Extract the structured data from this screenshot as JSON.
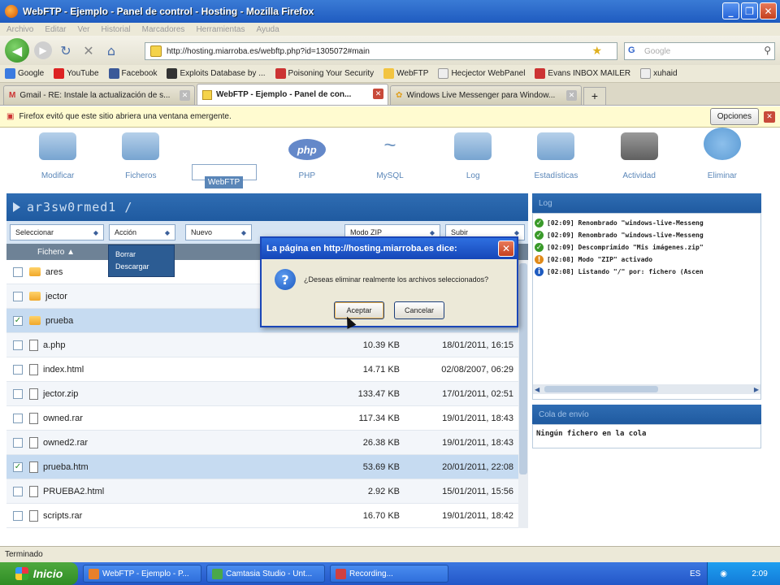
{
  "window": {
    "title": "WebFTP - Ejemplo - Panel de control - Hosting - Mozilla Firefox"
  },
  "menu": [
    "Archivo",
    "Editar",
    "Ver",
    "Historial",
    "Marcadores",
    "Herramientas",
    "Ayuda"
  ],
  "address": {
    "url": "http://hosting.miarroba.es/webftp.php?id=1305072#main",
    "search_placeholder": "Google",
    "search_engine_label": "G"
  },
  "bookmarks": [
    {
      "label": "Google",
      "color": "#3b7be0"
    },
    {
      "label": "YouTube",
      "color": "#d22"
    },
    {
      "label": "Facebook",
      "color": "#3b5998"
    },
    {
      "label": "Exploits Database by ...",
      "color": "#333"
    },
    {
      "label": "Poisoning Your Security",
      "color": "#c33"
    },
    {
      "label": "WebFTP",
      "color": "#f2c440"
    },
    {
      "label": "Hecjector WebPanel",
      "color": "#eee"
    },
    {
      "label": "Evans INBOX MAILER",
      "color": "#c33"
    },
    {
      "label": "xuhaid",
      "color": "#eee"
    }
  ],
  "tabs": [
    {
      "label": "Gmail - RE: Instale la actualización de s...",
      "active": false
    },
    {
      "label": "WebFTP - Ejemplo - Panel de con...",
      "active": true
    },
    {
      "label": "Windows Live Messenger para Window...",
      "active": false
    }
  ],
  "newtab_label": "+",
  "notification": {
    "text": "Firefox evitó que este sitio abriera una ventana emergente.",
    "button": "Opciones"
  },
  "tools": [
    {
      "label": "Modificar",
      "selected": false
    },
    {
      "label": "Ficheros",
      "selected": false
    },
    {
      "label": "WebFTP",
      "selected": true
    },
    {
      "label": "PHP",
      "selected": false
    },
    {
      "label": "MySQL",
      "selected": false
    },
    {
      "label": "Log",
      "selected": false
    },
    {
      "label": "Estadísticas",
      "selected": false
    },
    {
      "label": "Actividad",
      "selected": false
    },
    {
      "label": "Eliminar",
      "selected": false
    }
  ],
  "php_logo_text": "php",
  "path": "ar3sw0rmed1 /",
  "selects": {
    "select": "Seleccionar",
    "action": "Acción",
    "new": "Nuevo",
    "mode": "Modo ZIP",
    "upload": "Subir"
  },
  "column_header": "Fichero ▲",
  "action_menu": [
    "Borrar",
    "Descargar"
  ],
  "files": [
    {
      "name": "ares",
      "type": "folder",
      "size": "",
      "date": "",
      "checked": false
    },
    {
      "name": "jector",
      "type": "folder",
      "size": "",
      "date": "",
      "checked": false
    },
    {
      "name": "prueba",
      "type": "folder",
      "size": "",
      "date": "",
      "checked": true
    },
    {
      "name": "a.php",
      "type": "file",
      "size": "10.39 KB",
      "date": "18/01/2011, 16:15",
      "checked": false
    },
    {
      "name": "index.html",
      "type": "file",
      "size": "14.71 KB",
      "date": "02/08/2007, 06:29",
      "checked": false
    },
    {
      "name": "jector.zip",
      "type": "file",
      "size": "133.47 KB",
      "date": "17/01/2011, 02:51",
      "checked": false
    },
    {
      "name": "owned.rar",
      "type": "file",
      "size": "117.34 KB",
      "date": "19/01/2011, 18:43",
      "checked": false
    },
    {
      "name": "owned2.rar",
      "type": "file",
      "size": "26.38 KB",
      "date": "19/01/2011, 18:43",
      "checked": false
    },
    {
      "name": "prueba.htm",
      "type": "file",
      "size": "53.69 KB",
      "date": "20/01/2011, 22:08",
      "checked": true
    },
    {
      "name": "PRUEBA2.html",
      "type": "file",
      "size": "2.92 KB",
      "date": "15/01/2011, 15:56",
      "checked": false
    },
    {
      "name": "scripts.rar",
      "type": "file",
      "size": "16.70 KB",
      "date": "19/01/2011, 18:42",
      "checked": false
    }
  ],
  "log": {
    "title": "Log",
    "entries": [
      {
        "icon": "check",
        "color": "#3a9a2a",
        "text": "[02:09] Renombrado \"windows-live-Messeng"
      },
      {
        "icon": "check",
        "color": "#3a9a2a",
        "text": "[02:09] Renombrado \"windows-live-Messeng"
      },
      {
        "icon": "check",
        "color": "#3a9a2a",
        "text": "[02:09] Descomprimido \"Mis imágenes.zip\""
      },
      {
        "icon": "warning",
        "color": "#e08a1a",
        "text": "[02:08] Modo \"ZIP\" activado"
      },
      {
        "icon": "info",
        "color": "#1e5bc0",
        "text": "[02:08] Listando \"/\" por: fichero (Ascen"
      }
    ]
  },
  "queue": {
    "title": "Cola de envío",
    "text": "Ningún fichero en la cola"
  },
  "statusbar": "Terminado",
  "dialog": {
    "title": "La página en http://hosting.miarroba.es dice:",
    "message": "¿Deseas eliminar realmente los archivos seleccionados?",
    "ok": "Aceptar",
    "cancel": "Cancelar"
  },
  "taskbar": {
    "start": "Inicio",
    "items": [
      {
        "label": "WebFTP - Ejemplo - P...",
        "color": "#e8802a"
      },
      {
        "label": "Camtasia Studio - Unt...",
        "color": "#4aa84a"
      },
      {
        "label": "Recording...",
        "color": "#d04040"
      }
    ],
    "lang": "ES",
    "time": "2:09"
  }
}
